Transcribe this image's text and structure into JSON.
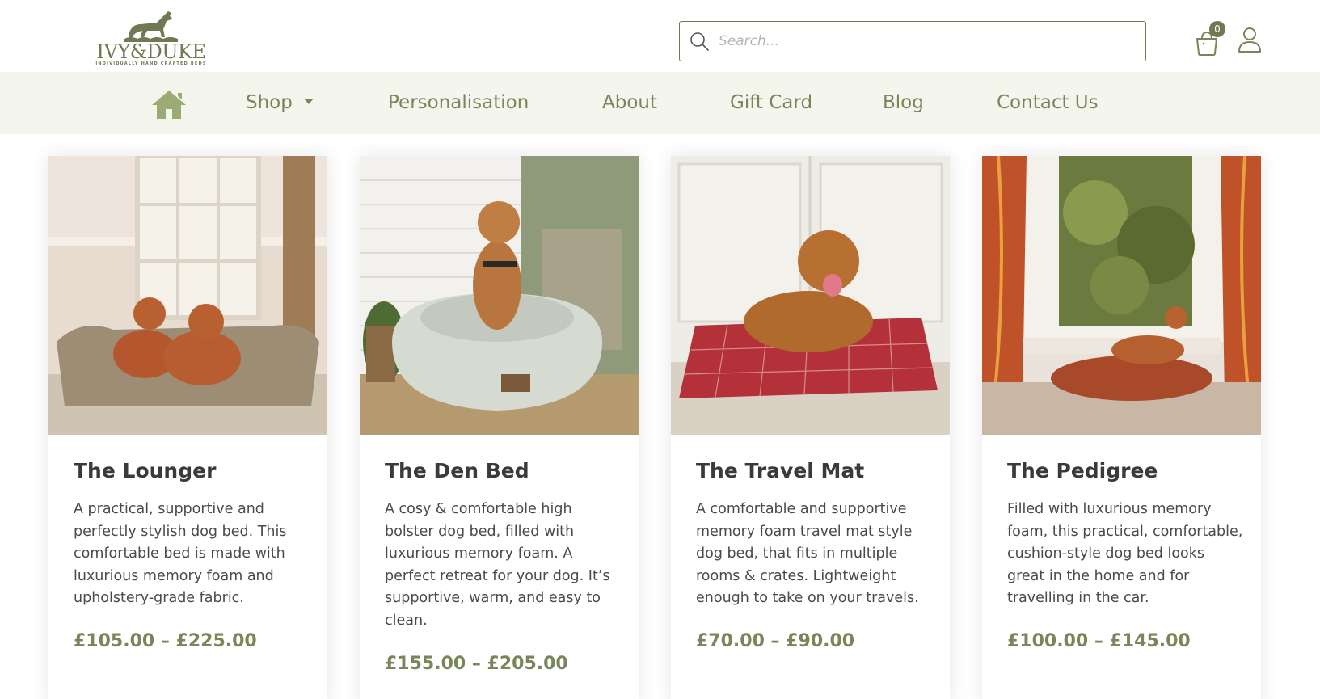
{
  "brand": {
    "name": "IVY&DUKE",
    "tagline": "Individually hand crafted beds"
  },
  "search": {
    "placeholder": "Search..."
  },
  "cart": {
    "count": "0"
  },
  "nav": {
    "items": [
      {
        "label": "Shop",
        "has_dropdown": true
      },
      {
        "label": "Personalisation"
      },
      {
        "label": "About"
      },
      {
        "label": "Gift Card"
      },
      {
        "label": "Blog"
      },
      {
        "label": "Contact Us"
      }
    ]
  },
  "colors": {
    "accent": "#7a8559",
    "nav_bg": "#f4f5ec"
  },
  "products": [
    {
      "title": "The Lounger",
      "description": "A practical, supportive and perfectly stylish dog bed. This comfortable bed is made with luxurious memory foam and upholstery-grade fabric.",
      "price": "£105.00 – £225.00"
    },
    {
      "title": "The Den Bed",
      "description": "A cosy & comfortable high bolster dog bed, filled with luxurious memory foam. A perfect retreat for your dog. It’s supportive, warm, and easy to clean.",
      "price": "£155.00 – £205.00"
    },
    {
      "title": "The Travel Mat",
      "description": "A comfortable and supportive memory foam travel mat style dog bed, that fits in multiple rooms & crates. Lightweight enough to take on your travels.",
      "price": "£70.00 – £90.00"
    },
    {
      "title": "The Pedigree",
      "description": "Filled with luxurious memory foam, this practical, comfortable, cushion-style dog bed looks great in the home and for travelling in the car.",
      "price": "£100.00 – £145.00"
    }
  ]
}
